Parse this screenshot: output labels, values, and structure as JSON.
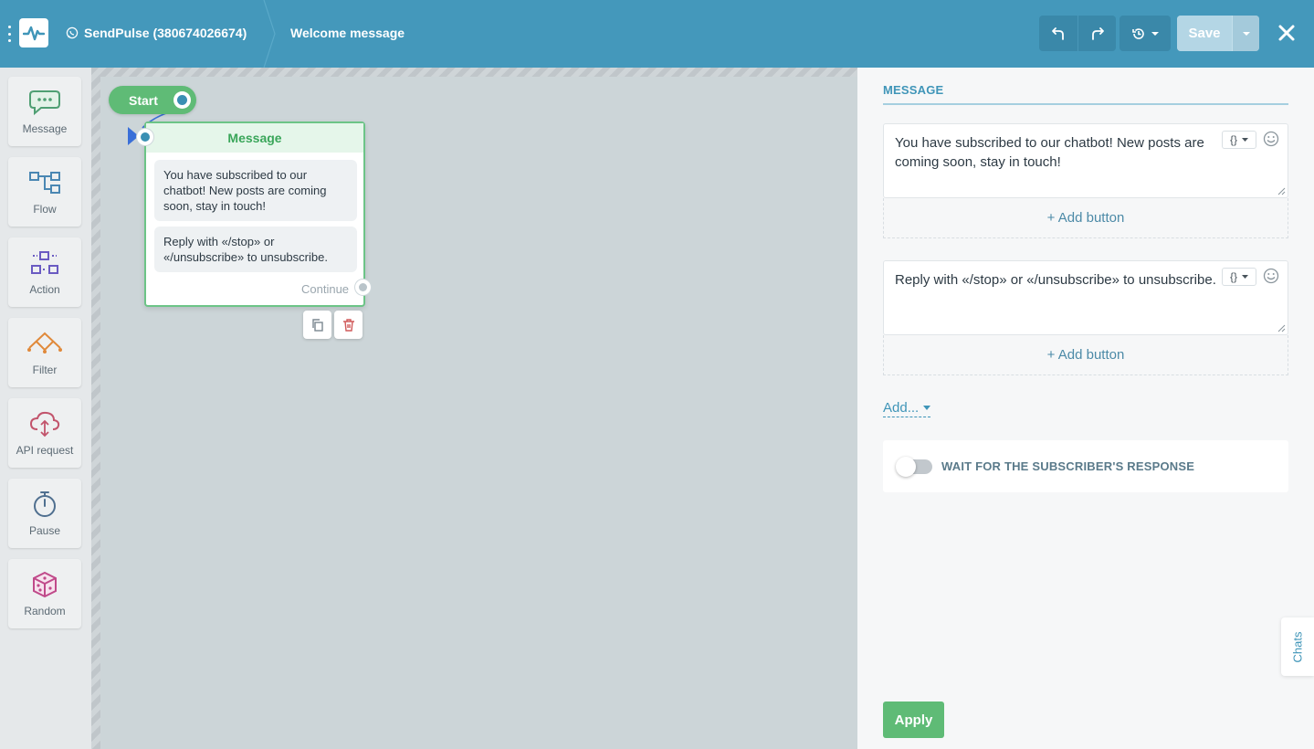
{
  "header": {
    "bot_name": "SendPulse (380674026674)",
    "flow_title": "Welcome message",
    "save_label": "Save",
    "icons": [
      "menu-dots-icon",
      "pulse-logo-icon",
      "whatsapp-icon",
      "undo-icon",
      "redo-icon",
      "history-icon",
      "chevron-down-icon",
      "close-icon"
    ]
  },
  "sidebar": {
    "items": [
      {
        "label": "Message",
        "icon": "chat-bubble-icon",
        "color": "#4f9f73"
      },
      {
        "label": "Flow",
        "icon": "flow-icon",
        "color": "#4a87b3"
      },
      {
        "label": "Action",
        "icon": "action-icon",
        "color": "#6a5bc2"
      },
      {
        "label": "Filter",
        "icon": "filter-icon",
        "color": "#e0893a"
      },
      {
        "label": "API request",
        "icon": "api-cloud-icon",
        "color": "#c2546c"
      },
      {
        "label": "Pause",
        "icon": "stopwatch-icon",
        "color": "#4f6f8f"
      },
      {
        "label": "Random",
        "icon": "dice-icon",
        "color": "#c04a8a"
      }
    ]
  },
  "canvas": {
    "start_label": "Start",
    "node": {
      "title": "Message",
      "messages": [
        "You have subscribed to our chatbot! New posts are coming soon, stay in touch!",
        "Reply with «/stop» or «/unsubscribe» to unsubscribe."
      ],
      "continue_label": "Continue"
    }
  },
  "panel": {
    "tab_label": "MESSAGE",
    "messages": [
      {
        "text": "You have subscribed to our chatbot! New posts are coming soon, stay in touch!",
        "var_label": "{}",
        "add_button": "+ Add button"
      },
      {
        "text": "Reply with «/stop» or «/unsubscribe» to unsubscribe.",
        "var_label": "{}",
        "add_button": "+ Add button"
      }
    ],
    "add_label": "Add...",
    "wait_label": "WAIT FOR THE SUBSCRIBER'S RESPONSE",
    "wait_enabled": false,
    "apply_label": "Apply"
  },
  "chats_label": "Chats",
  "colors": {
    "header": "#4498bb",
    "accent_green": "#5fbb76",
    "accent_blue": "#3f95b8"
  }
}
